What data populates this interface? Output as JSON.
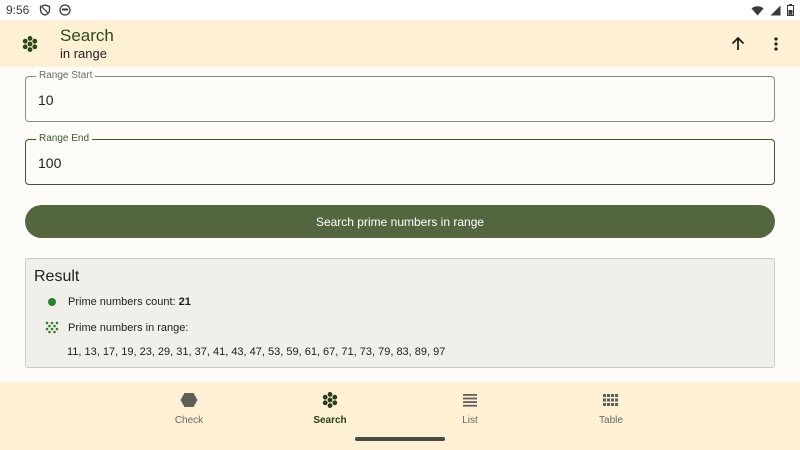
{
  "status_bar": {
    "time": "9:56"
  },
  "app_bar": {
    "title": "Search",
    "subtitle": "in range"
  },
  "range_start": {
    "label": "Range Start",
    "value": "10"
  },
  "range_end": {
    "label": "Range End",
    "value": "100"
  },
  "search_button": {
    "label": "Search prime numbers in range"
  },
  "result": {
    "title": "Result",
    "count_label": "Prime numbers count:",
    "count_value": "21",
    "list_label": "Prime numbers in range:",
    "primes": "11, 13, 17, 19, 23, 29, 31, 37, 41, 43, 47, 53, 59, 61, 67, 71, 73, 79, 83, 89, 97"
  },
  "bottom_nav": {
    "items": [
      {
        "label": "Check",
        "icon": "hexagon-icon",
        "active": false
      },
      {
        "label": "Search",
        "icon": "hex-cluster-icon",
        "active": true
      },
      {
        "label": "List",
        "icon": "list-icon",
        "active": false
      },
      {
        "label": "Table",
        "icon": "grid-icon",
        "active": false
      }
    ]
  },
  "colors": {
    "accent": "#536640",
    "app_bar_bg": "#fdf0d5",
    "title": "#2e4a18",
    "result_bg": "#f1efe9",
    "dot_green": "#2e7d32"
  }
}
